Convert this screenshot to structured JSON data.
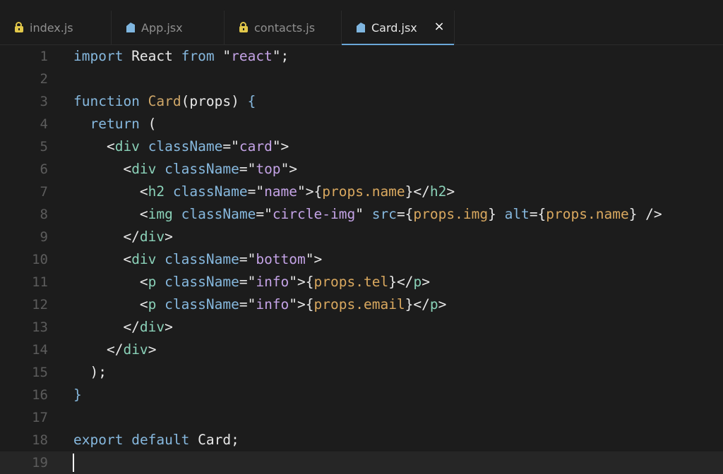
{
  "tabs": [
    {
      "label": "index.js",
      "icon": "js-file-icon",
      "active": false
    },
    {
      "label": "App.jsx",
      "icon": "react-file-icon",
      "active": false
    },
    {
      "label": "contacts.js",
      "icon": "js-file-icon",
      "active": false
    },
    {
      "label": "Card.jsx",
      "icon": "react-file-icon",
      "active": true
    }
  ],
  "close_glyph": "×",
  "line_numbers": [
    "1",
    "2",
    "3",
    "4",
    "5",
    "6",
    "7",
    "8",
    "9",
    "10",
    "11",
    "12",
    "13",
    "14",
    "15",
    "16",
    "17",
    "18",
    "19"
  ],
  "code_lines": [
    [
      [
        "kw",
        "import"
      ],
      [
        "plain",
        " React "
      ],
      [
        "kw",
        "from"
      ],
      [
        "plain",
        " \""
      ],
      [
        "str",
        "react"
      ],
      [
        "plain",
        "\";"
      ]
    ],
    [],
    [
      [
        "kw",
        "function"
      ],
      [
        "plain",
        " "
      ],
      [
        "fn",
        "Card"
      ],
      [
        "plain",
        "(props) "
      ],
      [
        "kw",
        "{"
      ]
    ],
    [
      [
        "plain",
        "  "
      ],
      [
        "kw",
        "return"
      ],
      [
        "plain",
        " ("
      ]
    ],
    [
      [
        "plain",
        "    <"
      ],
      [
        "tag",
        "div"
      ],
      [
        "plain",
        " "
      ],
      [
        "attr",
        "className"
      ],
      [
        "plain",
        "=\""
      ],
      [
        "str",
        "card"
      ],
      [
        "plain",
        "\">"
      ]
    ],
    [
      [
        "plain",
        "      <"
      ],
      [
        "tag",
        "div"
      ],
      [
        "plain",
        " "
      ],
      [
        "attr",
        "className"
      ],
      [
        "plain",
        "=\""
      ],
      [
        "str",
        "top"
      ],
      [
        "plain",
        "\">"
      ]
    ],
    [
      [
        "plain",
        "        <"
      ],
      [
        "tag",
        "h2"
      ],
      [
        "plain",
        " "
      ],
      [
        "attr",
        "className"
      ],
      [
        "plain",
        "=\""
      ],
      [
        "str",
        "name"
      ],
      [
        "plain",
        "\">{"
      ],
      [
        "var",
        "props.name"
      ],
      [
        "plain",
        "}</"
      ],
      [
        "tag",
        "h2"
      ],
      [
        "plain",
        ">"
      ]
    ],
    [
      [
        "plain",
        "        <"
      ],
      [
        "tag",
        "img"
      ],
      [
        "plain",
        " "
      ],
      [
        "attr",
        "className"
      ],
      [
        "plain",
        "=\""
      ],
      [
        "str",
        "circle-img"
      ],
      [
        "plain",
        "\" "
      ],
      [
        "attr",
        "src"
      ],
      [
        "plain",
        "={"
      ],
      [
        "var",
        "props.img"
      ],
      [
        "plain",
        "} "
      ],
      [
        "attr",
        "alt"
      ],
      [
        "plain",
        "={"
      ],
      [
        "var",
        "props.name"
      ],
      [
        "plain",
        "} />"
      ]
    ],
    [
      [
        "plain",
        "      </"
      ],
      [
        "tag",
        "div"
      ],
      [
        "plain",
        ">"
      ]
    ],
    [
      [
        "plain",
        "      <"
      ],
      [
        "tag",
        "div"
      ],
      [
        "plain",
        " "
      ],
      [
        "attr",
        "className"
      ],
      [
        "plain",
        "=\""
      ],
      [
        "str",
        "bottom"
      ],
      [
        "plain",
        "\">"
      ]
    ],
    [
      [
        "plain",
        "        <"
      ],
      [
        "tag",
        "p"
      ],
      [
        "plain",
        " "
      ],
      [
        "attr",
        "className"
      ],
      [
        "plain",
        "=\""
      ],
      [
        "str",
        "info"
      ],
      [
        "plain",
        "\">{"
      ],
      [
        "var",
        "props.tel"
      ],
      [
        "plain",
        "}</"
      ],
      [
        "tag",
        "p"
      ],
      [
        "plain",
        ">"
      ]
    ],
    [
      [
        "plain",
        "        <"
      ],
      [
        "tag",
        "p"
      ],
      [
        "plain",
        " "
      ],
      [
        "attr",
        "className"
      ],
      [
        "plain",
        "=\""
      ],
      [
        "str",
        "info"
      ],
      [
        "plain",
        "\">{"
      ],
      [
        "var",
        "props.email"
      ],
      [
        "plain",
        "}</"
      ],
      [
        "tag",
        "p"
      ],
      [
        "plain",
        ">"
      ]
    ],
    [
      [
        "plain",
        "      </"
      ],
      [
        "tag",
        "div"
      ],
      [
        "plain",
        ">"
      ]
    ],
    [
      [
        "plain",
        "    </"
      ],
      [
        "tag",
        "div"
      ],
      [
        "plain",
        ">"
      ]
    ],
    [
      [
        "plain",
        "  );"
      ]
    ],
    [
      [
        "kw",
        "}"
      ]
    ],
    [],
    [
      [
        "kw",
        "export"
      ],
      [
        "plain",
        " "
      ],
      [
        "kw",
        "default"
      ],
      [
        "plain",
        " Card;"
      ]
    ],
    []
  ],
  "cursor_line": 19
}
